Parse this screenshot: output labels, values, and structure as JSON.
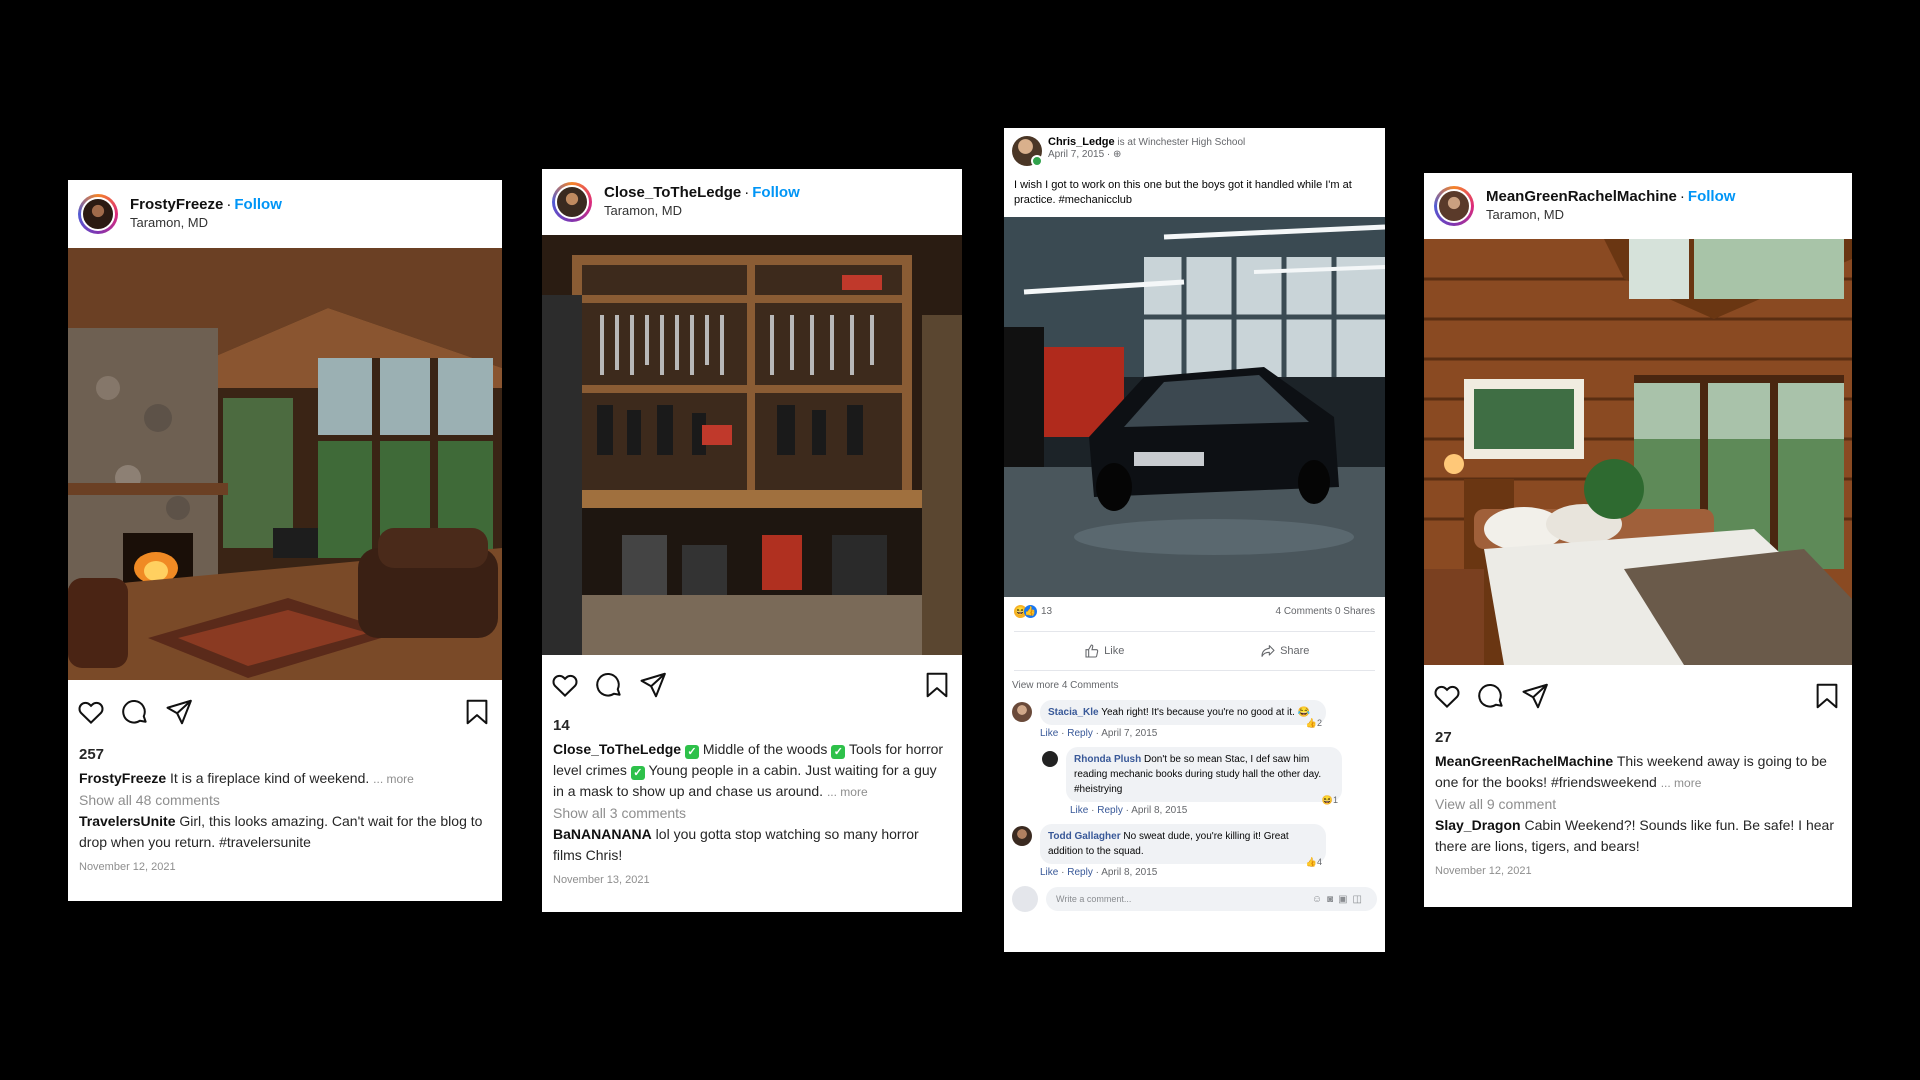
{
  "posts": [
    {
      "username": "FrostyFreeze",
      "dot": "·",
      "follow": "Follow",
      "location": "Taramon, MD",
      "likes": "257",
      "caption_user": "FrostyFreeze",
      "caption": "It is a fireplace kind of weekend.",
      "more": "... more",
      "show_comments": "Show all 48 comments",
      "comment_user": "TravelersUnite",
      "comment_text": "Girl, this looks amazing. Can't wait for the blog to drop when you return. #travelersunite",
      "date": "November 12, 2021"
    },
    {
      "username": "Close_ToTheLedge",
      "dot": "·",
      "follow": "Follow",
      "location": "Taramon, MD",
      "likes": "14",
      "caption_user": "Close_ToTheLedge",
      "caption_parts": [
        "Middle of the woods",
        "Tools for horror level crimes",
        "Young people in a cabin. Just waiting for a guy in a mask to show up and chase us around."
      ],
      "more": "... more",
      "show_comments": "Show all 3 comments",
      "comment_user": "BaNANANANA",
      "comment_text": "lol you gotta stop watching so many horror films Chris!",
      "date": "November 13, 2021"
    },
    {
      "username": "MeanGreenRachelMachine",
      "dot": "·",
      "follow": "Follow",
      "location": "Taramon, MD",
      "likes": "27",
      "caption_user": "MeanGreenRachelMachine",
      "caption": "This weekend away is going to be one for the books! #friendsweekend",
      "more": "... more",
      "show_comments": "View all 9 comment",
      "comment_user": "Slay_Dragon",
      "comment_text": "Cabin Weekend?! Sounds like fun. Be safe! I hear there are lions, tigers, and bears!",
      "date": "November 12, 2021"
    }
  ],
  "fb": {
    "username": "Chris_Ledge",
    "checkin": "is at Winchester High School",
    "time": "April 7, 2015 · ",
    "text": "I wish I got to work on this one but the boys got it handled while I'm at practice. #mechanicclub",
    "reaction_count": "13",
    "stats": "4 Comments 0 Shares",
    "like": "Like",
    "share": "Share",
    "view_more": "View more 4 Comments",
    "comments": [
      {
        "name": "Stacia_Kle",
        "text": "Yeah right! It's because you're no good at it. 😂",
        "like": "Like",
        "reply": "Reply",
        "date": "April 7, 2015",
        "count": "2"
      },
      {
        "name": "Rhonda Plush",
        "text": "Don't be so mean Stac, I def saw him reading mechanic books during study hall the other day. #heistrying",
        "like": "Like",
        "reply": "Reply",
        "date": "April 8, 2015",
        "count": "1"
      },
      {
        "name": "Todd Gallagher",
        "text": "No sweat dude, you're killing it! Great addition to the squad.",
        "like": "Like",
        "reply": "Reply",
        "date": "April 8, 2015",
        "count": "4"
      }
    ],
    "write_placeholder": "Write a comment...",
    "separator": "·"
  }
}
